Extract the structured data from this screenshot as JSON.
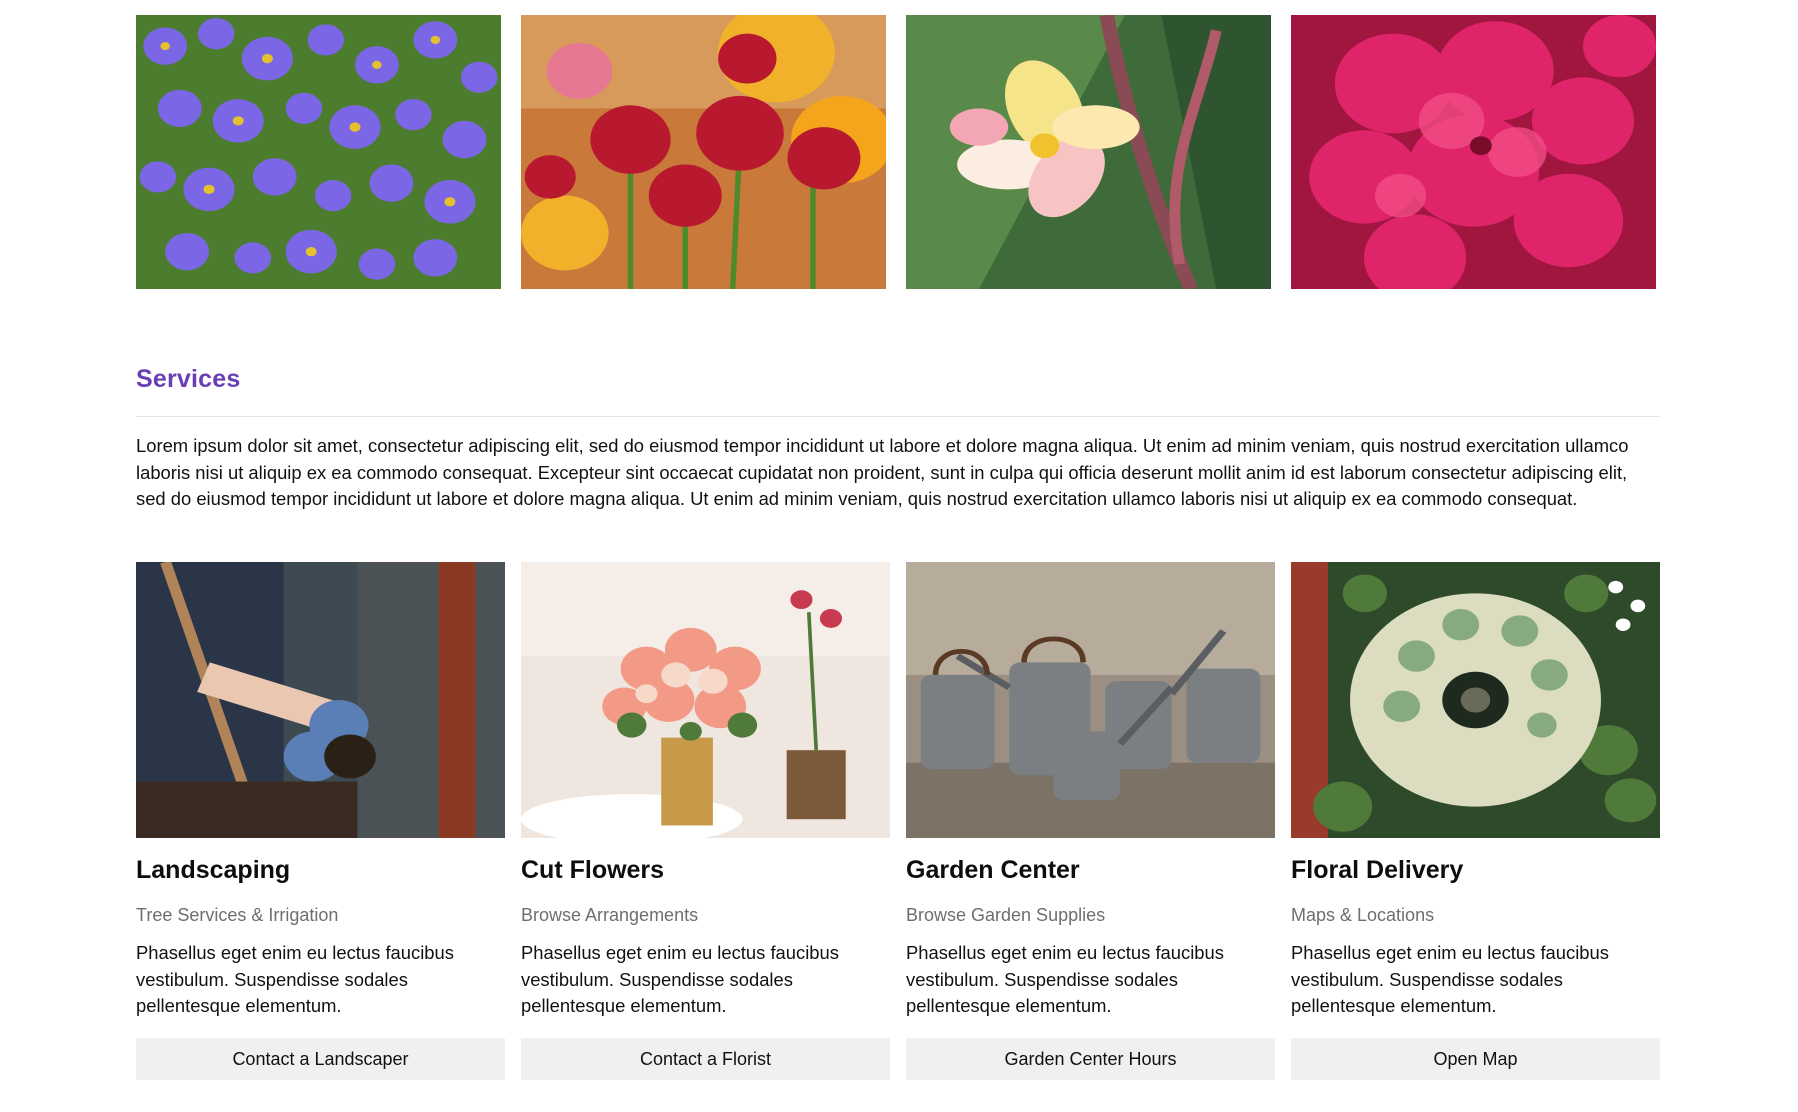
{
  "colors": {
    "accent": "#6a3fb4",
    "divider": "#e3e3e3",
    "button_bg": "#f0f0f0",
    "subtitle": "#6e6e6e"
  },
  "gallery": [
    {
      "name": "purple-asters-photo"
    },
    {
      "name": "red-daisies-photo"
    },
    {
      "name": "frangipani-photo"
    },
    {
      "name": "pink-geranium-photo"
    }
  ],
  "services": {
    "heading": "Services",
    "body": "Lorem ipsum dolor sit amet, consectetur adipiscing elit, sed do eiusmod tempor incididunt ut labore et dolore magna aliqua. Ut enim ad minim veniam, quis nostrud exercitation ullamco laboris nisi ut aliquip ex ea commodo consequat. Excepteur sint occaecat cupidatat non proident, sunt in culpa qui officia deserunt mollit anim id est laborum consectetur adipiscing elit, sed do eiusmod tempor incididunt ut labore et dolore magna aliqua. Ut enim ad minim veniam, quis nostrud exercitation ullamco laboris nisi ut aliquip ex ea commodo consequat."
  },
  "cards": [
    {
      "title": "Landscaping",
      "subtitle": "Tree Services & Irrigation",
      "text": "Phasellus eget enim eu lectus faucibus vestibulum. Suspendisse sodales pellentesque elementum.",
      "button": "Contact a Landscaper"
    },
    {
      "title": "Cut Flowers",
      "subtitle": "Browse Arrangements",
      "text": "Phasellus eget enim eu lectus faucibus vestibulum. Suspendisse sodales pellentesque elementum.",
      "button": "Contact a Florist"
    },
    {
      "title": "Garden Center",
      "subtitle": "Browse Garden Supplies",
      "text": "Phasellus eget enim eu lectus faucibus vestibulum. Suspendisse sodales pellentesque elementum.",
      "button": "Garden Center Hours"
    },
    {
      "title": "Floral Delivery",
      "subtitle": "Maps & Locations",
      "text": "Phasellus eget enim eu lectus faucibus vestibulum. Suspendisse sodales pellentesque elementum.",
      "button": "Open Map"
    }
  ]
}
